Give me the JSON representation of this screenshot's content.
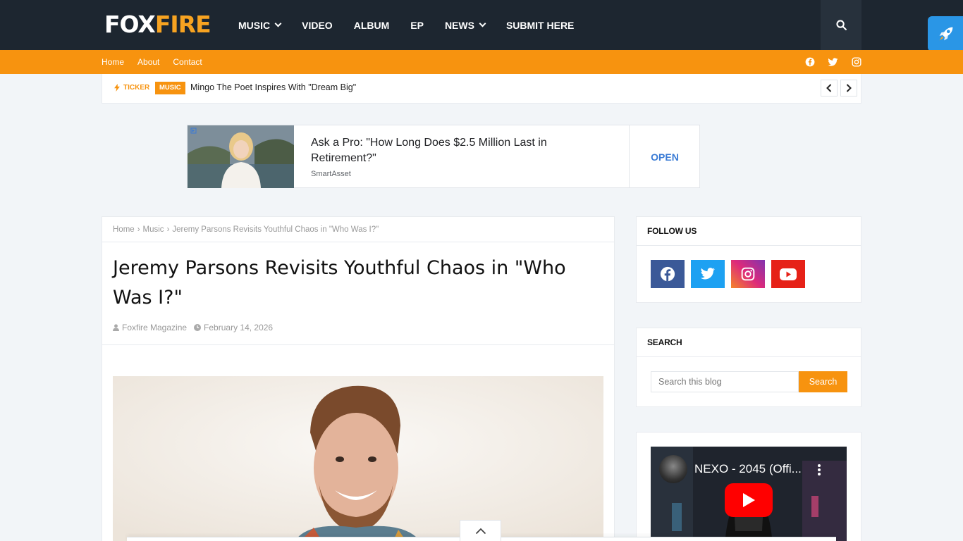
{
  "logo": {
    "part1": "FOX",
    "part2": "FIRE"
  },
  "nav": [
    {
      "label": "MUSIC",
      "dropdown": true
    },
    {
      "label": "VIDEO",
      "dropdown": false
    },
    {
      "label": "ALBUM",
      "dropdown": false
    },
    {
      "label": "EP",
      "dropdown": false
    },
    {
      "label": "NEWS",
      "dropdown": true
    },
    {
      "label": "SUBMIT HERE",
      "dropdown": false
    }
  ],
  "subnav": [
    "Home",
    "About",
    "Contact"
  ],
  "social_top": [
    "facebook-icon",
    "twitter-icon",
    "instagram-icon"
  ],
  "ticker": {
    "label": "TICKER",
    "badge": "MUSIC",
    "headline": "Mingo The Poet Inspires With \"Dream Big\""
  },
  "ad": {
    "title": "Ask a Pro: \"How Long Does $2.5 Million Last in Retirement?\"",
    "source": "SmartAsset",
    "cta": "OPEN"
  },
  "breadcrumb": {
    "home": "Home",
    "category": "Music",
    "current": "Jeremy Parsons Revisits Youthful Chaos in \"Who Was I?\"",
    "separator": "›"
  },
  "post": {
    "title": "Jeremy Parsons Revisits Youthful Chaos in \"Who Was I?\"",
    "author": "Foxfire Magazine",
    "date": "February 14, 2026"
  },
  "sidebar": {
    "follow": {
      "heading": "FOLLOW US",
      "icons": [
        {
          "name": "facebook-icon",
          "color": "#3b5998"
        },
        {
          "name": "twitter-icon",
          "color": "#1da1f2"
        },
        {
          "name": "instagram-icon",
          "color": "#c13584"
        },
        {
          "name": "youtube-icon",
          "color": "#e62117"
        }
      ]
    },
    "search": {
      "heading": "SEARCH",
      "placeholder": "Search this blog",
      "button": "Search"
    },
    "video": {
      "title": "NEXO - 2045 (Offi..."
    }
  },
  "colors": {
    "navbar": "#1d2630",
    "accent": "#f7930f",
    "logo_accent": "#f7a321",
    "ad_cta": "#3a7bd5"
  }
}
